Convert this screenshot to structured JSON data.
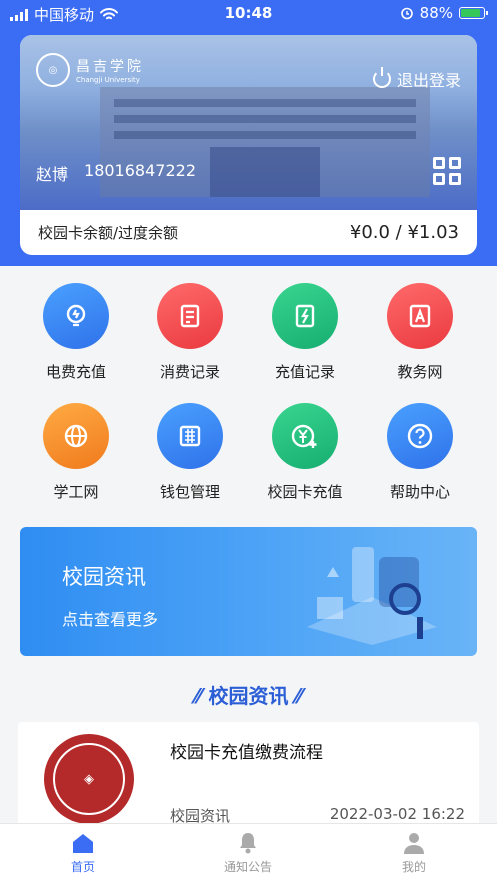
{
  "status_bar": {
    "carrier": "中国移动",
    "time": "10:48",
    "battery": "88%"
  },
  "card": {
    "school_name": "昌吉学院",
    "school_name_en": "Changji University",
    "logout_label": "退出登录",
    "user_name": "赵博",
    "user_phone": "18016847222",
    "balance_label": "校园卡余额/过度余额",
    "balance_value": "¥0.0 / ¥1.03"
  },
  "services": [
    {
      "label": "电费充值",
      "icon": "lightbulb-icon",
      "color": "#2f82f0"
    },
    {
      "label": "消费记录",
      "icon": "receipt-icon",
      "color": "#f0454a"
    },
    {
      "label": "充值记录",
      "icon": "recharge-record-icon",
      "color": "#1fba7d"
    },
    {
      "label": "教务网",
      "icon": "letter-a-icon",
      "color": "#f0454a"
    },
    {
      "label": "学工网",
      "icon": "globe-icon",
      "color": "#f68a25"
    },
    {
      "label": "钱包管理",
      "icon": "wallet-grid-icon",
      "color": "#2f82f0"
    },
    {
      "label": "校园卡充值",
      "icon": "yen-plus-icon",
      "color": "#1fba7d"
    },
    {
      "label": "帮助中心",
      "icon": "help-icon",
      "color": "#2f82f0"
    }
  ],
  "banner": {
    "title": "校园资讯",
    "subtitle": "点击查看更多"
  },
  "section": {
    "title": "校园资讯"
  },
  "news": [
    {
      "title": "校园卡充值缴费流程",
      "category": "校园资讯",
      "date": "2022-03-02 16:22"
    }
  ],
  "tabs": [
    {
      "label": "首页",
      "icon": "home-icon",
      "active": true
    },
    {
      "label": "通知公告",
      "icon": "bell-icon",
      "active": false
    },
    {
      "label": "我的",
      "icon": "person-icon",
      "active": false
    }
  ],
  "colors": {
    "primary": "#3a6cf4",
    "section_title": "#2c5fd6"
  }
}
